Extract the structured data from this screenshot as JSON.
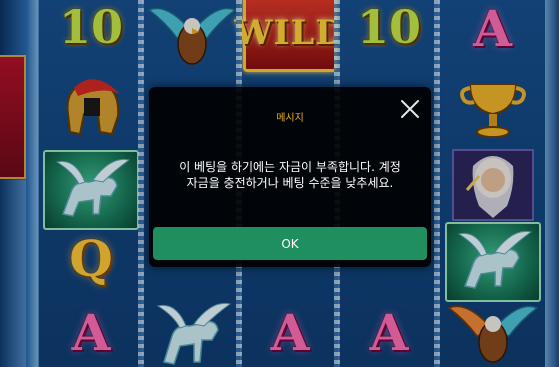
{
  "dialog": {
    "title": "메시지",
    "message_line1": "이 베팅을 하기에는 자금이 부족합니다. 계정",
    "message_line2": "자금을 충전하거나 베팅 수준을 낮추세요.",
    "ok_label": "OK",
    "close_icon": "close-icon"
  },
  "reels": [
    {
      "rows": [
        "10",
        "helmet",
        "pegasus",
        "Q",
        "A"
      ]
    },
    {
      "rows": [
        "eagle",
        "",
        "",
        "",
        "pegasus"
      ]
    },
    {
      "rows": [
        "WILD",
        "",
        "",
        "",
        "A"
      ]
    },
    {
      "rows": [
        "10",
        "",
        "",
        "",
        "A"
      ]
    },
    {
      "rows": [
        "A",
        "chalice",
        "zeus",
        "pegasus",
        "eagle"
      ]
    }
  ],
  "symbols": {
    "r1_top": "10",
    "r1_row4": "Q",
    "r1_row5": "A",
    "r3_top": "WILD",
    "r3_row5": "A",
    "r4_top": "10",
    "r4_row5": "A",
    "r5_top": "A"
  },
  "colors": {
    "accent_title": "#f0b020",
    "ok_button": "#1f8f5f",
    "modal_bg": "#000000"
  }
}
